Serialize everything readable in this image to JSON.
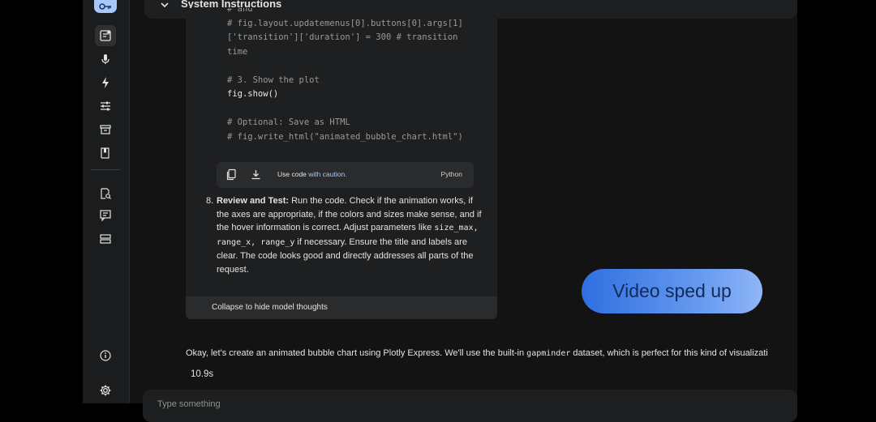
{
  "system_instructions": {
    "title": "System Instructions"
  },
  "code_lines": [
    {
      "text": "# and",
      "style": "c"
    },
    {
      "text": "# fig.layout.updatemenus[0].buttons[0].args[1]",
      "style": "c"
    },
    {
      "text": "['transition']['duration'] = 300 # transition",
      "style": "c"
    },
    {
      "text": "time",
      "style": "c"
    },
    {
      "text": "",
      "style": "c"
    },
    {
      "text": "# 3. Show the plot",
      "style": "c"
    },
    {
      "text": "fig.show()",
      "style": "w"
    },
    {
      "text": "",
      "style": "c"
    },
    {
      "text": "# Optional: Save as HTML",
      "style": "c"
    },
    {
      "text": "# fig.write_html(\"animated_bubble_chart.html\")",
      "style": "c"
    }
  ],
  "code_toolbar": {
    "copy_icon": "copy-icon",
    "download_icon": "download-icon",
    "caution_prefix": "Use code ",
    "caution_link": "with caution.",
    "language": "Python"
  },
  "step": {
    "number": "8.",
    "title": "Review and Test:",
    "text1": " Run the code. Check if the animation works, if the axes are appropriate, if the colors and sizes make sense, and if the hover information is correct. Adjust parameters like ",
    "code1": "size_max",
    "sep1": ", ",
    "code2": "range_x",
    "sep2": ", ",
    "code3": "range_y",
    "text2": " if necessary. Ensure the title and labels are clear. The code looks good and directly addresses all parts of the request."
  },
  "collapse_label": "Collapse to hide model thoughts",
  "video_overlay": "Video sped up",
  "response": {
    "before": "Okay, let's create an animated bubble chart using Plotly Express. We'll use the built-in ",
    "code": "gapminder",
    "after": " dataset, which is perfect for this kind of visualizati"
  },
  "timing": "10.9s",
  "prompt_placeholder": "Type something",
  "colors": {
    "accent": "#a8c7fa",
    "pill_start": "#2f6fe0",
    "pill_end": "#8fb6f7"
  }
}
